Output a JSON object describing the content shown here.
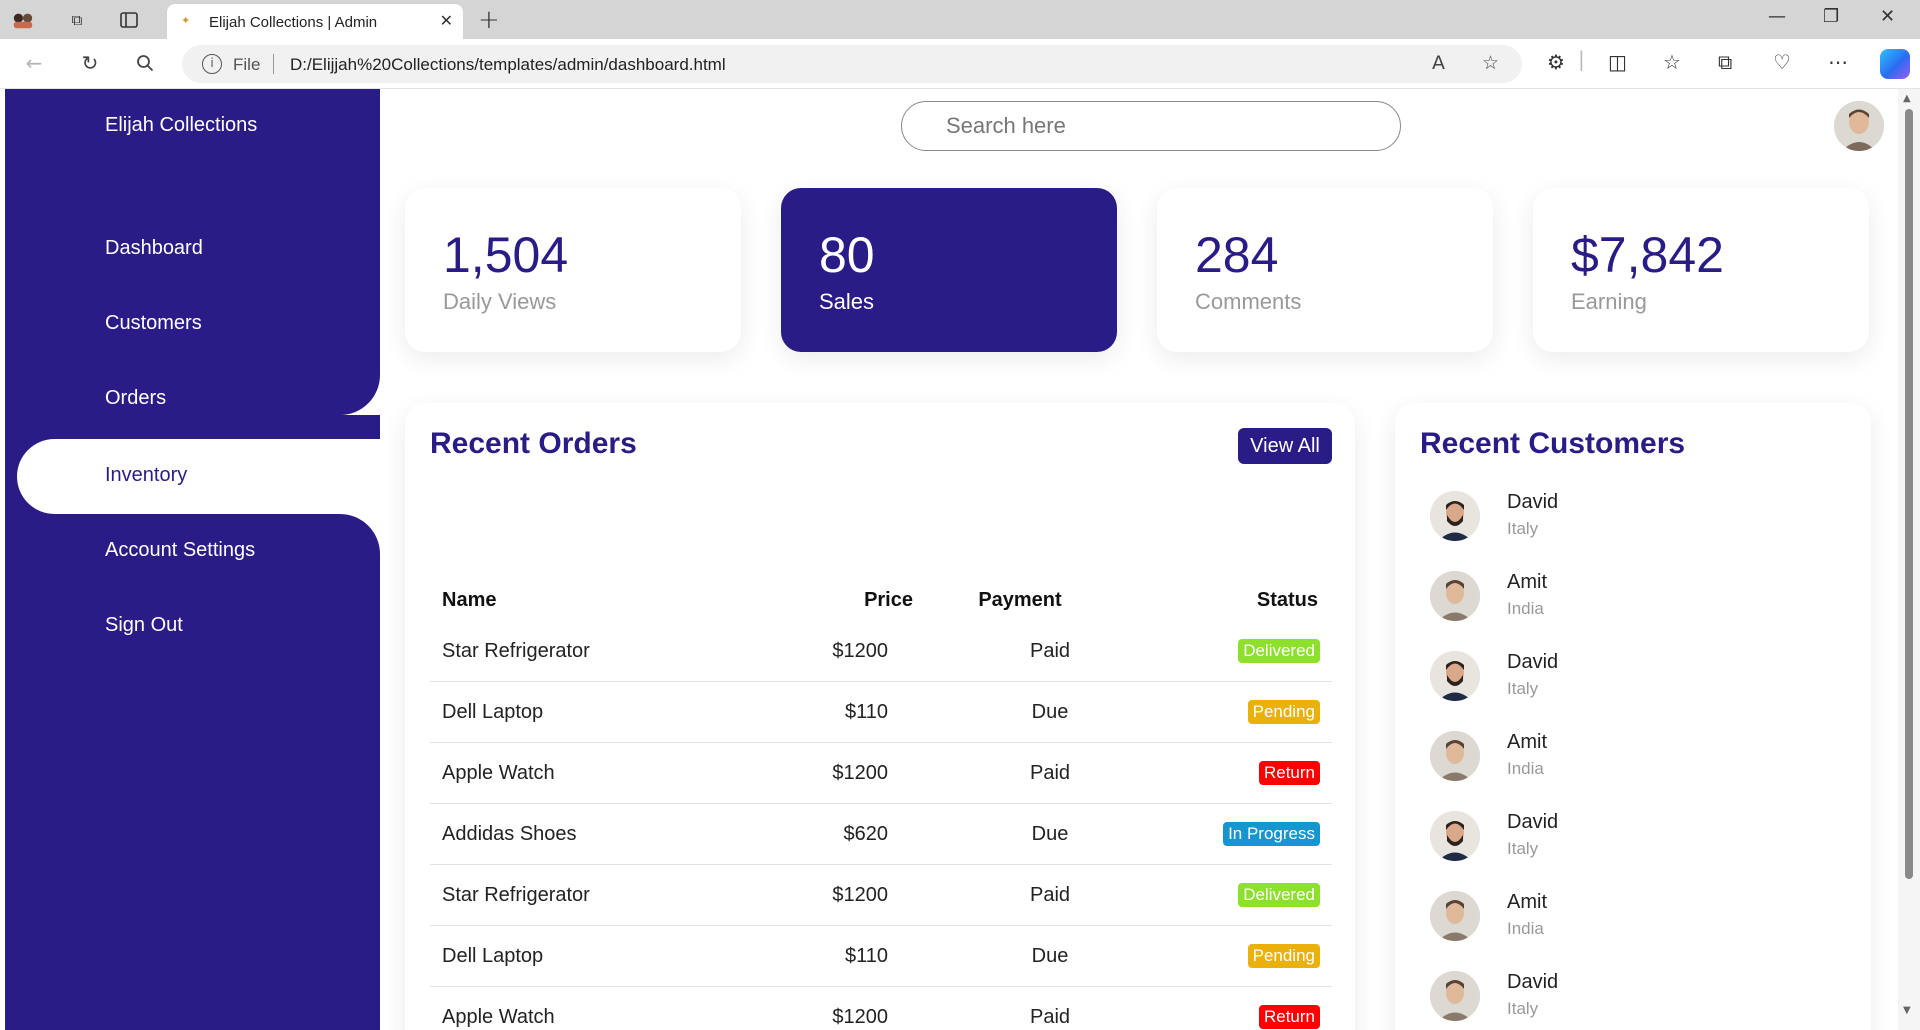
{
  "browser": {
    "tab_title": "Elijah Collections | Admin",
    "url_scheme_label": "File",
    "url": "D:/Elijjah%20Collections/templates/admin/dashboard.html"
  },
  "sidebar": {
    "brand": "Elijah Collections",
    "items": [
      {
        "label": "Dashboard"
      },
      {
        "label": "Customers"
      },
      {
        "label": "Orders"
      },
      {
        "label": "Inventory"
      },
      {
        "label": "Account Settings"
      },
      {
        "label": "Sign Out"
      }
    ],
    "active_item": "Inventory",
    "color": "#2a1c87"
  },
  "search": {
    "placeholder": "Search here"
  },
  "cards": [
    {
      "number": "1,504",
      "label": "Daily Views"
    },
    {
      "number": "80",
      "label": "Sales"
    },
    {
      "number": "284",
      "label": "Comments"
    },
    {
      "number": "$7,842",
      "label": "Earning"
    }
  ],
  "recent_orders": {
    "title": "Recent Orders",
    "view_all_label": "View All",
    "headers": {
      "name": "Name",
      "price": "Price",
      "payment": "Payment",
      "status": "Status"
    },
    "rows": [
      {
        "name": "Star Refrigerator",
        "price": "$1200",
        "payment": "Paid",
        "status": "Delivered"
      },
      {
        "name": "Dell Laptop",
        "price": "$110",
        "payment": "Due",
        "status": "Pending"
      },
      {
        "name": "Apple Watch",
        "price": "$1200",
        "payment": "Paid",
        "status": "Return"
      },
      {
        "name": "Addidas Shoes",
        "price": "$620",
        "payment": "Due",
        "status": "In Progress"
      },
      {
        "name": "Star Refrigerator",
        "price": "$1200",
        "payment": "Paid",
        "status": "Delivered"
      },
      {
        "name": "Dell Laptop",
        "price": "$110",
        "payment": "Due",
        "status": "Pending"
      },
      {
        "name": "Apple Watch",
        "price": "$1200",
        "payment": "Paid",
        "status": "Return"
      }
    ],
    "status_colors": {
      "Delivered": "#8de02c",
      "Pending": "#e9b10a",
      "Return": "#ff0000",
      "In Progress": "#1795ce"
    }
  },
  "recent_customers": {
    "title": "Recent Customers",
    "list": [
      {
        "name": "David",
        "country": "Italy"
      },
      {
        "name": "Amit",
        "country": "India"
      },
      {
        "name": "David",
        "country": "Italy"
      },
      {
        "name": "Amit",
        "country": "India"
      },
      {
        "name": "David",
        "country": "Italy"
      },
      {
        "name": "Amit",
        "country": "India"
      },
      {
        "name": "David",
        "country": "Italy"
      }
    ]
  }
}
